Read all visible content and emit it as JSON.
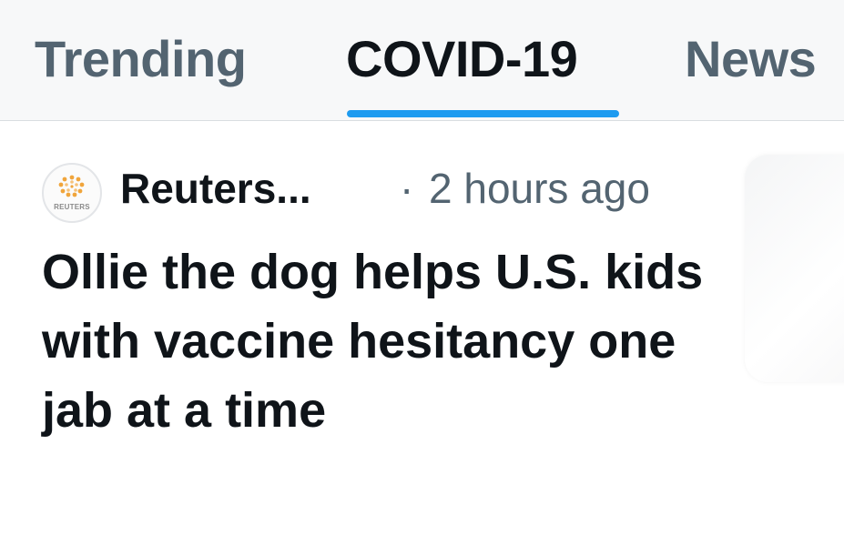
{
  "tabs": [
    {
      "label": "Trending",
      "selected": false
    },
    {
      "label": "COVID-19",
      "selected": true
    },
    {
      "label": "News",
      "selected": false
    }
  ],
  "colors": {
    "accent": "#1d9bf0",
    "text_primary": "#0f1419",
    "text_secondary": "#536471",
    "tabbar_bg": "#f7f8f9"
  },
  "story": {
    "source": {
      "name": "Reuters...",
      "avatar_icon": "reuters-logo-icon",
      "avatar_text": "REUTERS"
    },
    "time_separator": "·",
    "time": "2 hours ago",
    "headline": "Ollie the dog helps U.S. kids with vaccine hesitancy one jab at a time"
  }
}
